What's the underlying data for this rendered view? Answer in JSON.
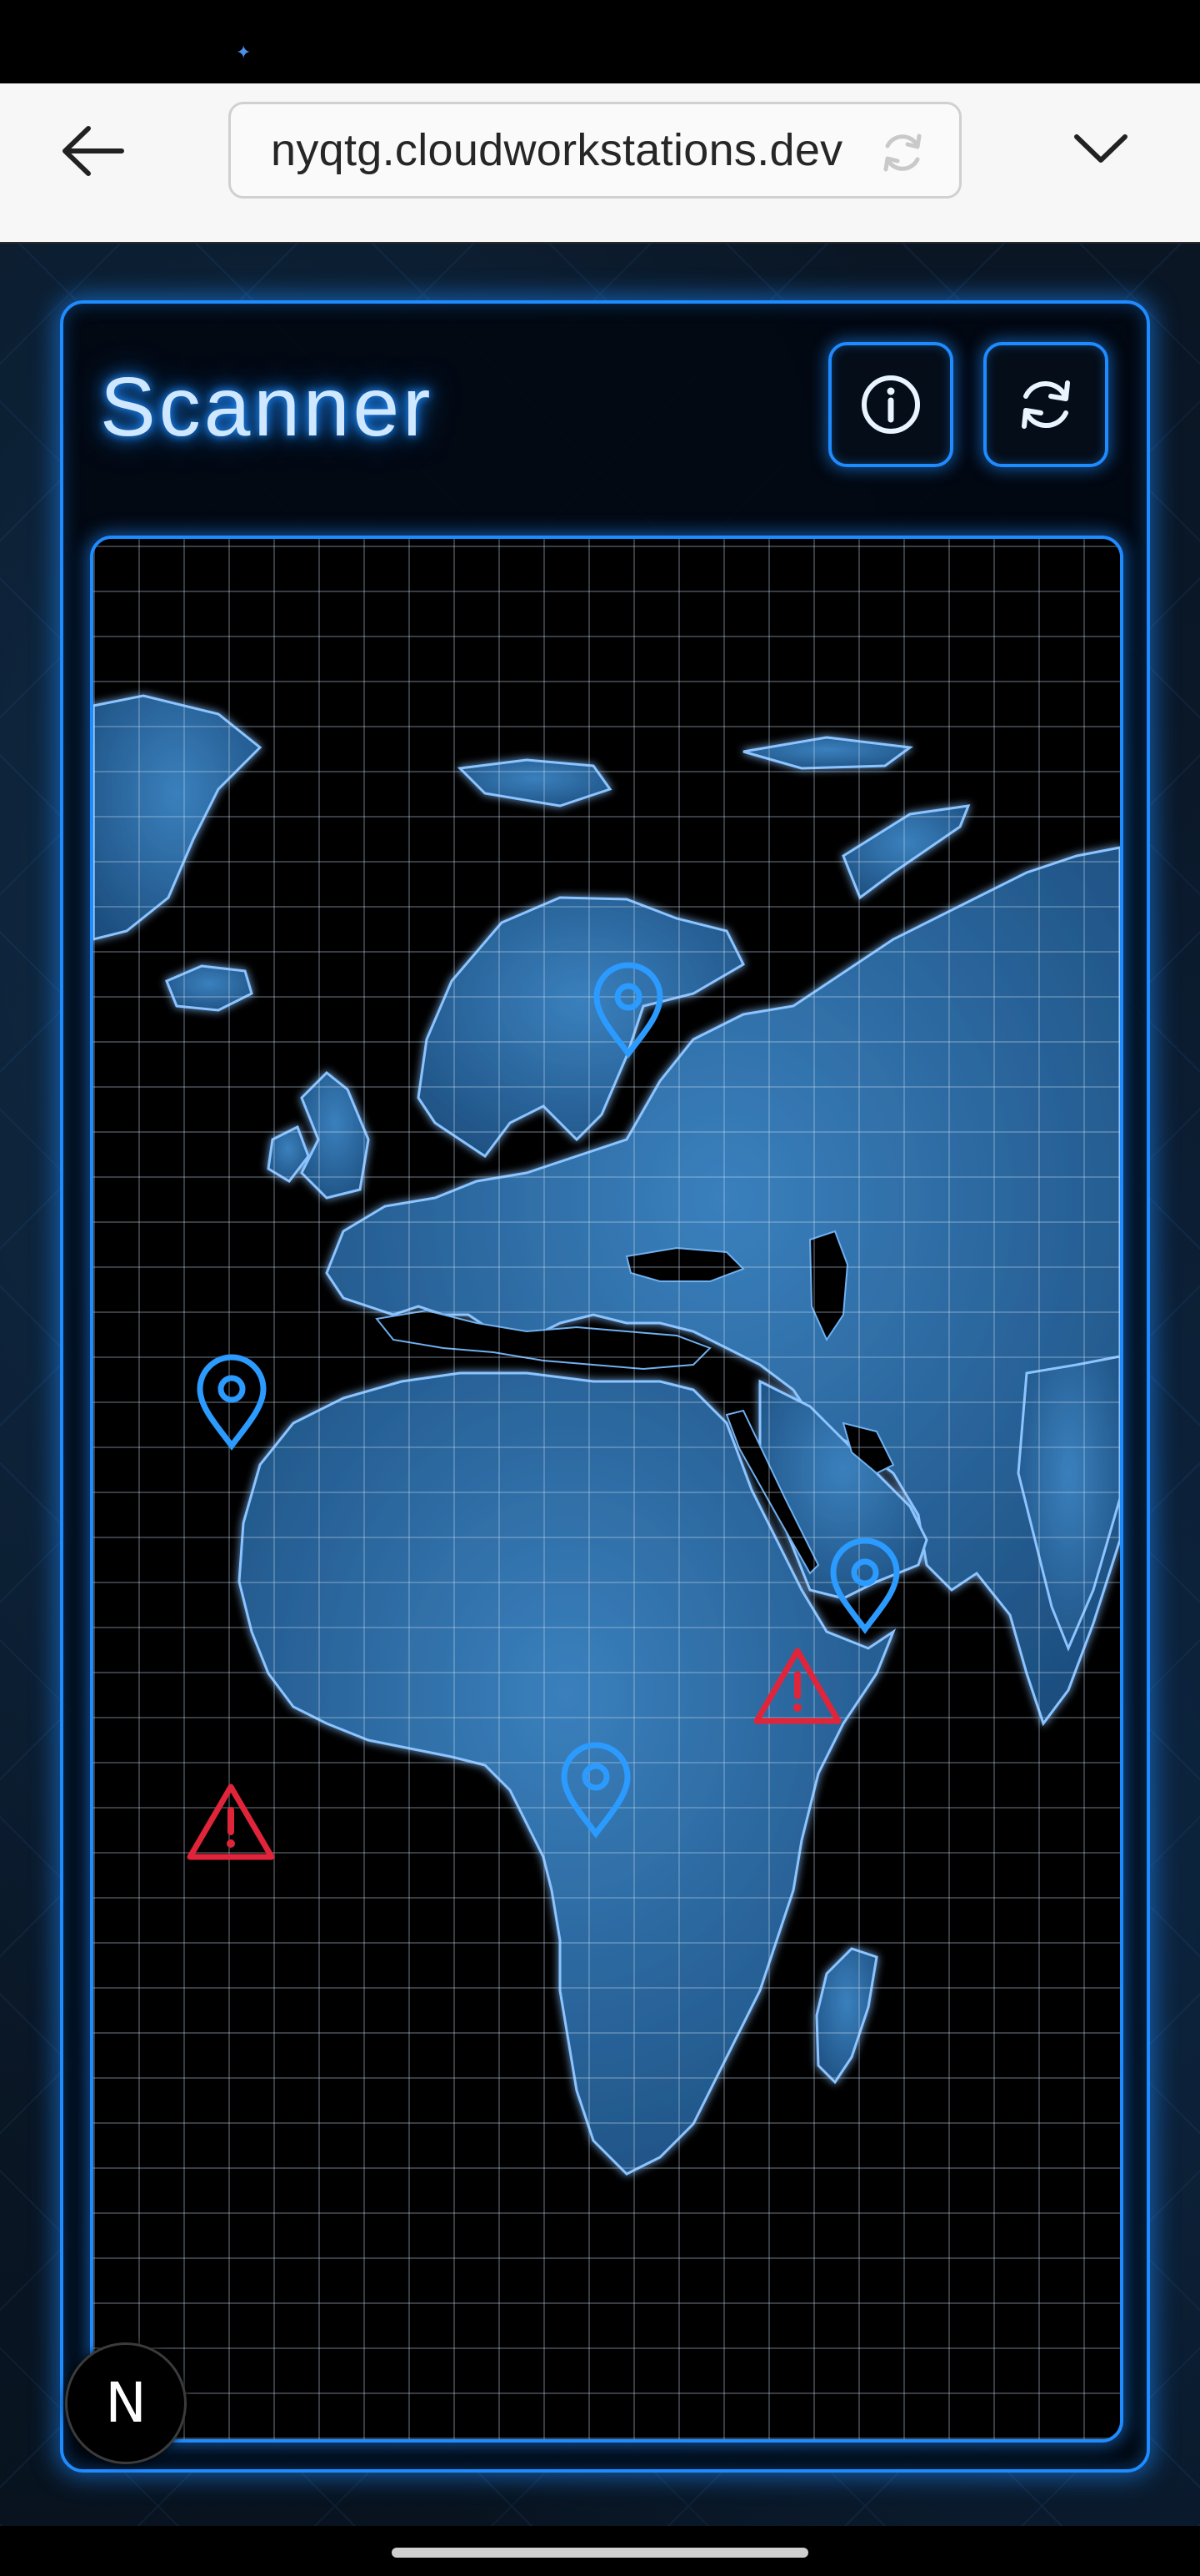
{
  "browser": {
    "url": "nyqtg.cloudworkstations.dev",
    "icons": {
      "back": "arrow-left-icon",
      "reload": "reload-icon",
      "menu": "chevron-down-icon"
    }
  },
  "app": {
    "title": "Scanner",
    "buttons": {
      "info": "info-icon",
      "refresh": "refresh-icon"
    },
    "badge": "N"
  },
  "map": {
    "markers": [
      {
        "kind": "location",
        "region": "Scandinavia"
      },
      {
        "kind": "location",
        "region": "Northwest Africa"
      },
      {
        "kind": "location",
        "region": "Arabian Peninsula"
      },
      {
        "kind": "location",
        "region": "Central Africa"
      },
      {
        "kind": "warning",
        "region": "Horn of Africa"
      },
      {
        "kind": "warning",
        "region": "Atlantic Ocean"
      }
    ]
  },
  "colors": {
    "accent": "#1e8bff",
    "warning": "#e0253a",
    "land": "#2e6ea6",
    "page_bg": "#0a1624"
  }
}
